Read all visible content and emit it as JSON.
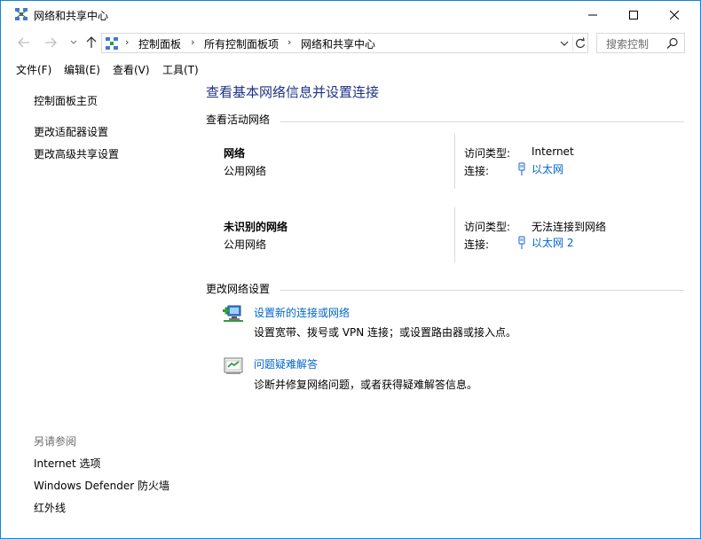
{
  "window": {
    "title": "网络和共享中心",
    "title_icon": "network-center-icon"
  },
  "address": {
    "crumbs": [
      "控制面板",
      "所有控制面板项",
      "网络和共享中心"
    ],
    "search_placeholder": "搜索控制"
  },
  "menu": {
    "items": [
      "文件(F)",
      "编辑(E)",
      "查看(V)",
      "工具(T)"
    ]
  },
  "left": {
    "home": "控制面板主页",
    "links": [
      "更改适配器设置",
      "更改高级共享设置"
    ],
    "see_also_heading": "另请参阅",
    "see_also": [
      "Internet 选项",
      "Windows Defender 防火墙",
      "红外线"
    ]
  },
  "main": {
    "title": "查看基本网络信息并设置连接",
    "active_heading": "查看活动网络",
    "networks": [
      {
        "name": "网络",
        "category": "公用网络",
        "access_label": "访问类型:",
        "access_value": "Internet",
        "conn_label": "连接:",
        "conn_value": "以太网"
      },
      {
        "name": "未识别的网络",
        "category": "公用网络",
        "access_label": "访问类型:",
        "access_value": "无法连接到网络",
        "conn_label": "连接:",
        "conn_value": "以太网 2"
      }
    ],
    "change_heading": "更改网络设置",
    "tasks": [
      {
        "link": "设置新的连接或网络",
        "desc": "设置宽带、拨号或 VPN 连接；或设置路由器或接入点。",
        "icon": "new-connection-icon"
      },
      {
        "link": "问题疑难解答",
        "desc": "诊断并修复网络问题，或者获得疑难解答信息。",
        "icon": "troubleshoot-icon"
      }
    ]
  },
  "colors": {
    "title_blue": "#1e3287",
    "link_blue": "#0066cc",
    "window_border": "#1883d7"
  }
}
